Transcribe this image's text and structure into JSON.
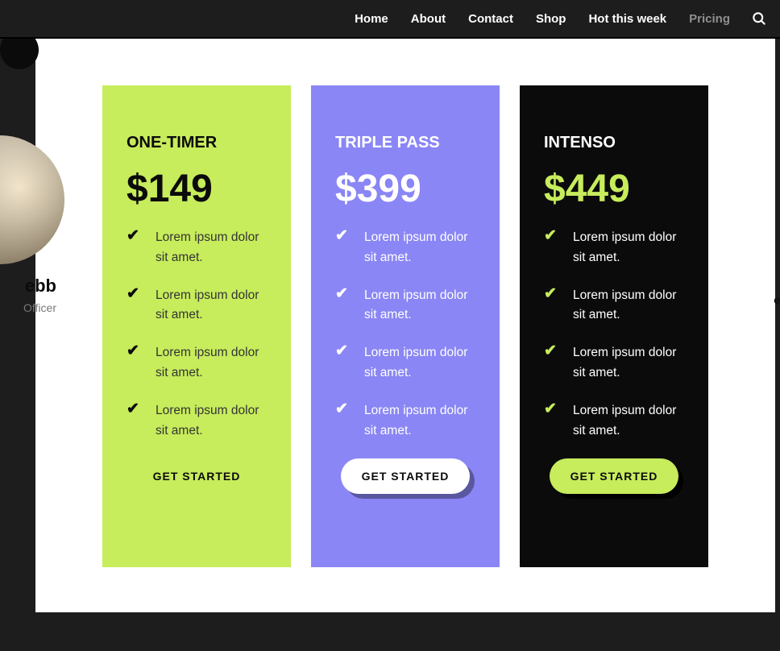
{
  "nav": {
    "items": [
      {
        "label": "Home",
        "active": false
      },
      {
        "label": "About",
        "active": false
      },
      {
        "label": "Contact",
        "active": false
      },
      {
        "label": "Shop",
        "active": false
      },
      {
        "label": "Hot this week",
        "active": false
      },
      {
        "label": "Pricing",
        "active": true
      }
    ]
  },
  "left_peek": {
    "name": "ebb",
    "role": "Officer"
  },
  "right_peek": {
    "letter": "e"
  },
  "pricing": {
    "plans": [
      {
        "title": "ONE-TIMER",
        "price": "$149",
        "features": [
          "Lorem ipsum dolor sit amet.",
          "Lorem ipsum dolor sit amet.",
          "Lorem ipsum dolor sit amet.",
          "Lorem ipsum dolor sit amet."
        ],
        "cta": "GET STARTED"
      },
      {
        "title": "TRIPLE PASS",
        "price": "$399",
        "features": [
          "Lorem ipsum dolor sit amet.",
          "Lorem ipsum dolor sit amet.",
          "Lorem ipsum dolor sit amet.",
          "Lorem ipsum dolor sit amet."
        ],
        "cta": "GET STARTED"
      },
      {
        "title": "INTENSO",
        "price": "$449",
        "features": [
          "Lorem ipsum dolor sit amet.",
          "Lorem ipsum dolor sit amet.",
          "Lorem ipsum dolor sit amet.",
          "Lorem ipsum dolor sit amet."
        ],
        "cta": "GET STARTED"
      }
    ]
  },
  "colors": {
    "lime": "#c7ec5c",
    "violet": "#8a86f5",
    "black": "#0b0b0b"
  }
}
